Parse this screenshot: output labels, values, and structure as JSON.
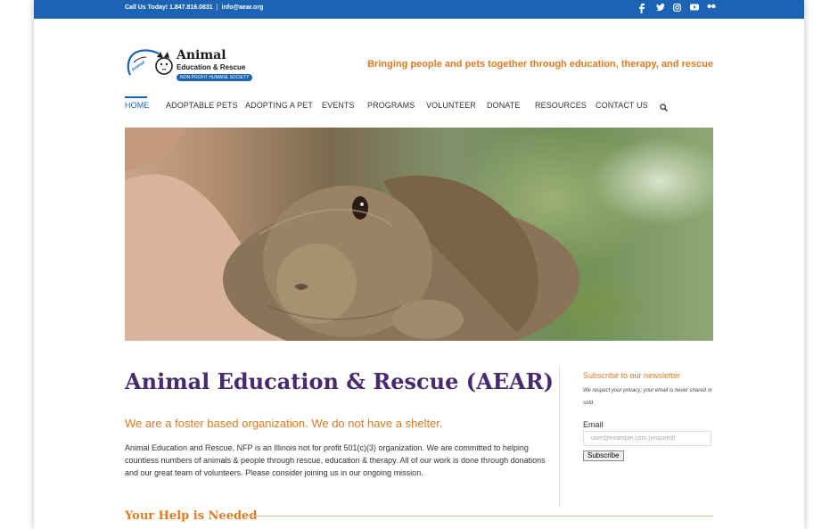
{
  "topbar": {
    "contact_text": "Call Us Today! 1.847.816.0831",
    "separator": "|",
    "email": "info@aear.org",
    "social_icons": [
      "facebook-icon",
      "twitter-icon",
      "instagram-icon",
      "youtube-icon",
      "flickr-icon"
    ]
  },
  "logo": {
    "line1": "Animal",
    "line2": "Education & Rescue",
    "badge": "NON-PROFIT HUMANE SOCIETY"
  },
  "tagline": "Bringing people and pets together through education, therapy, and rescue",
  "nav": {
    "items": [
      "HOME",
      "ADOPTABLE PETS",
      "ADOPTING A PET",
      "EVENTS",
      "PROGRAMS",
      "VOLUNTEER",
      "DONATE",
      "RESOURCES",
      "CONTACT US"
    ],
    "active": "HOME"
  },
  "main": {
    "heading": "Animal Education & Rescue (AEAR)",
    "subheading": "We are a foster based organization. We do not have a shelter.",
    "paragraph": "Animal Education and Rescue, NFP is an Illinois not for profit 501(c)(3) organization. We are committed to helping countless numbers of animals & people through rescue, education & therapy. All of our work is done through donations and our great team of volunteers. Please consider joining us in our ongoing mission.",
    "section_title": "Your Help is Needed"
  },
  "newsletter": {
    "title": "Subscribe to our newsletter",
    "note": "We respect your privacy; your email is never shared or sold.",
    "email_label": "Email",
    "email_placeholder": "user@example.com (required)",
    "subscribe_label": "Subscribe"
  },
  "colors": {
    "topbar": "#1c63b4",
    "accent_orange": "#e07b22",
    "heading_purple": "#4a2a6e"
  }
}
